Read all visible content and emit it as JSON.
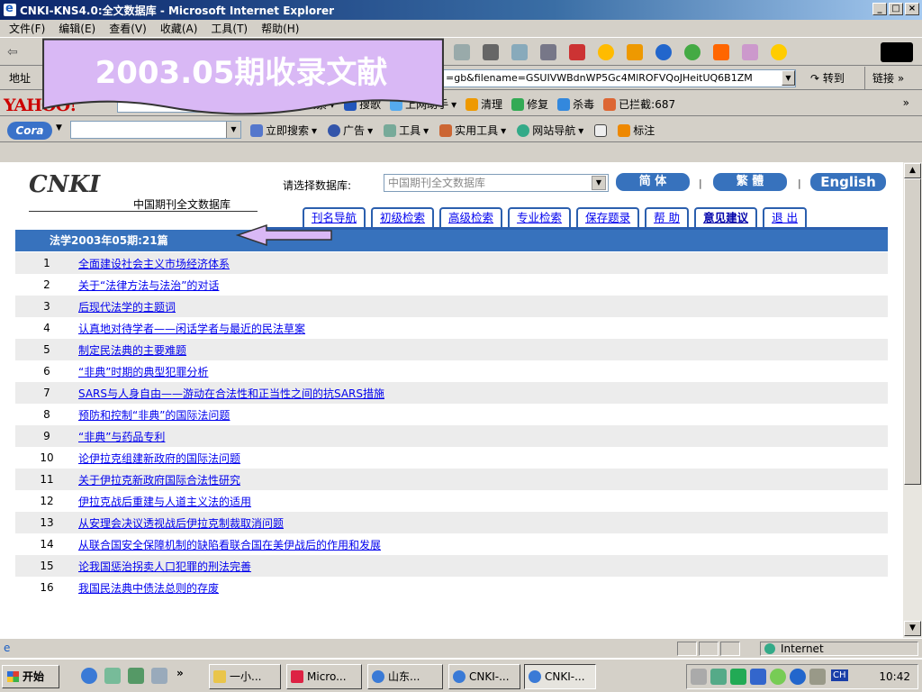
{
  "window": {
    "title": "CNKI-KNS4.0:全文数据库 - Microsoft Internet Explorer",
    "min_label": "_",
    "max_label": "□",
    "close_label": "×"
  },
  "menu": [
    "文件(F)",
    "编辑(E)",
    "查看(V)",
    "收藏(A)",
    "工具(T)",
    "帮助(H)"
  ],
  "address": {
    "label": "地址",
    "url": "=gb&filename=GSUIVWBdnWP5Gc4MlROFVQoJHeitUQ6B1ZM",
    "goto_label": "转到",
    "links_label": "链接 »"
  },
  "yahoo": {
    "logo": "YAHOO!",
    "tools": [
      "搜索",
      "搜歌",
      "上网助手",
      "清理",
      "修复",
      "杀毒",
      "已拦截:687"
    ],
    "more": "»"
  },
  "cora": {
    "logo": "Cora",
    "tools": [
      "立即搜索",
      "广告",
      "工具",
      "实用工具",
      "网站导航",
      "标注"
    ]
  },
  "callout": {
    "text": "2003.05期收录文献",
    "fill": "#d9b8f5",
    "stroke": "#333333"
  },
  "cnki": {
    "logo": "CNKI",
    "subtitle": "中国期刊全文数据库",
    "db_label": "请选择数据库:",
    "db_selected": "中国期刊全文数据库",
    "lang_buttons": [
      "简 体",
      "繁 體",
      "English"
    ],
    "nav_tabs": [
      "刊名导航",
      "初级检索",
      "高级检索",
      "专业检索",
      "保存题录",
      "帮 助",
      "意见建议",
      "退 出"
    ],
    "list_header": "法学2003年05期:21篇",
    "accent": "#3772bd"
  },
  "articles": [
    {
      "num": "1",
      "title": "全面建设社会主义市场经济体系"
    },
    {
      "num": "2",
      "title": "关于“法律方法与法治”的对话"
    },
    {
      "num": "3",
      "title": "后现代法学的主题词"
    },
    {
      "num": "4",
      "title": "认真地对待学者——闲话学者与最近的民法草案"
    },
    {
      "num": "5",
      "title": "制定民法典的主要难题"
    },
    {
      "num": "6",
      "title": "“非典”时期的典型犯罪分析"
    },
    {
      "num": "7",
      "title": "SARS与人身自由——游动在合法性和正当性之间的抗SARS措施"
    },
    {
      "num": "8",
      "title": "预防和控制“非典”的国际法问题"
    },
    {
      "num": "9",
      "title": "“非典”与药品专利"
    },
    {
      "num": "10",
      "title": "论伊拉克组建新政府的国际法问题"
    },
    {
      "num": "11",
      "title": "关于伊拉克新政府国际合法性研究"
    },
    {
      "num": "12",
      "title": "伊拉克战后重建与人道主义法的适用"
    },
    {
      "num": "13",
      "title": "从安理会决议透视战后伊拉克制裁取消问题"
    },
    {
      "num": "14",
      "title": "从联合国安全保障机制的缺陷看联合国在美伊战后的作用和发展"
    },
    {
      "num": "15",
      "title": "论我国惩治拐卖人口犯罪的刑法完善"
    },
    {
      "num": "16",
      "title": "我国民法典中债法总则的存废"
    }
  ],
  "status": {
    "zone": "Internet"
  },
  "taskbar": {
    "start": "开始",
    "tasks": [
      "一小...",
      "Micro...",
      "山东...",
      "CNKI-...",
      "CNKI-..."
    ],
    "ime": "CH",
    "clock": "10:42"
  }
}
